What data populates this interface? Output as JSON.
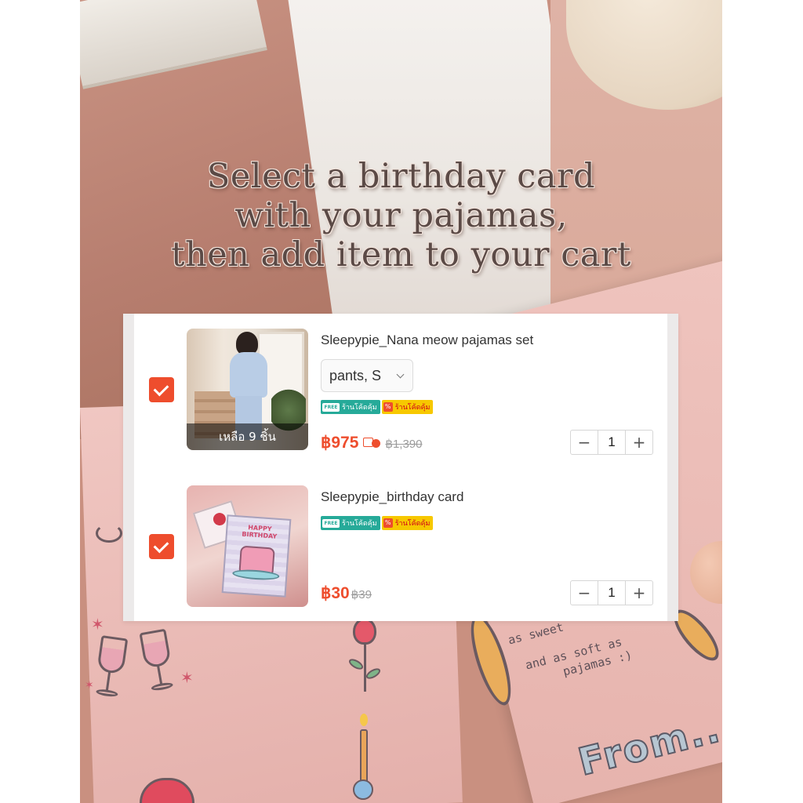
{
  "headline": {
    "line1": "Select a birthday card",
    "line2": "with your pajamas,",
    "line3": "then add item to your cart"
  },
  "cart": {
    "items": [
      {
        "title": "Sleepypie_Nana meow pajamas set",
        "variant": "pants, S",
        "stock_overlay": "เหลือ 9 ชิ้น",
        "badges": [
          "ร้านโค้ดคุ้ม",
          "ร้านโค้ดคุ้ม"
        ],
        "badge_icons": [
          "FREE",
          "%"
        ],
        "price": "฿975",
        "old_price": "฿1,390",
        "quantity": "1",
        "selected": true
      },
      {
        "title": "Sleepypie_birthday card",
        "badges": [
          "ร้านโค้ดคุ้ม",
          "ร้านโค้ดคุ้ม"
        ],
        "badge_icons": [
          "FREE",
          "%"
        ],
        "price": "฿30",
        "old_price": "฿39",
        "quantity": "1",
        "selected": true,
        "thumb_text": "HAPPY BIRTHDAY"
      }
    ],
    "stepper": {
      "minus": "−",
      "plus": "+"
    }
  },
  "background_text": {
    "note_line1": "as sweet",
    "note_line2": "and as soft as",
    "note_line3": "pajamas :)",
    "from": "From.."
  },
  "colors": {
    "accent": "#ee4d2d",
    "ship_badge": "#26aa99",
    "coin_badge": "#f7c800"
  }
}
